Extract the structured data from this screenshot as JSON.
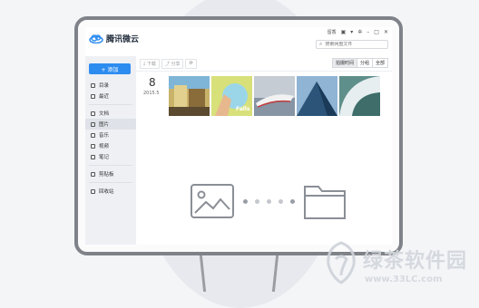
{
  "app": {
    "logo_text": "腾讯微云",
    "user_name": "留香",
    "search_placeholder": "搜索网盘文件"
  },
  "sidebar": {
    "upload_label": "+ 添加",
    "groups": [
      [
        {
          "label": "目录",
          "icon": "folder-icon"
        },
        {
          "label": "最近",
          "icon": "clock-icon"
        }
      ],
      [
        {
          "label": "文档",
          "icon": "document-icon"
        },
        {
          "label": "图片",
          "icon": "image-icon",
          "active": true
        },
        {
          "label": "音乐",
          "icon": "music-icon"
        },
        {
          "label": "视频",
          "icon": "video-icon"
        },
        {
          "label": "笔记",
          "icon": "note-icon"
        }
      ],
      [
        {
          "label": "剪贴板",
          "icon": "clipboard-icon"
        }
      ],
      [
        {
          "label": "回收站",
          "icon": "trash-icon"
        }
      ]
    ]
  },
  "toolbar": {
    "download_label": "下载",
    "share_label": "分享",
    "refresh_label": "⟳",
    "view_options": [
      "拍摄时间",
      "分组",
      "全部"
    ],
    "selected_view": "拍摄时间"
  },
  "gallery": {
    "date_day": "8",
    "date_year_month": "2015.5",
    "thumbnails": [
      "photo-street",
      "photo-hand-sign",
      "photo-boat",
      "photo-building",
      "photo-arch"
    ]
  },
  "transfer": {
    "source_icon": "image-icon",
    "target_icon": "folder-icon"
  },
  "watermark": {
    "text": "绿茶软件园",
    "url": "www.33LC.com"
  },
  "colors": {
    "accent": "#2d8cf0",
    "monitor_frame": "#7f8289"
  }
}
